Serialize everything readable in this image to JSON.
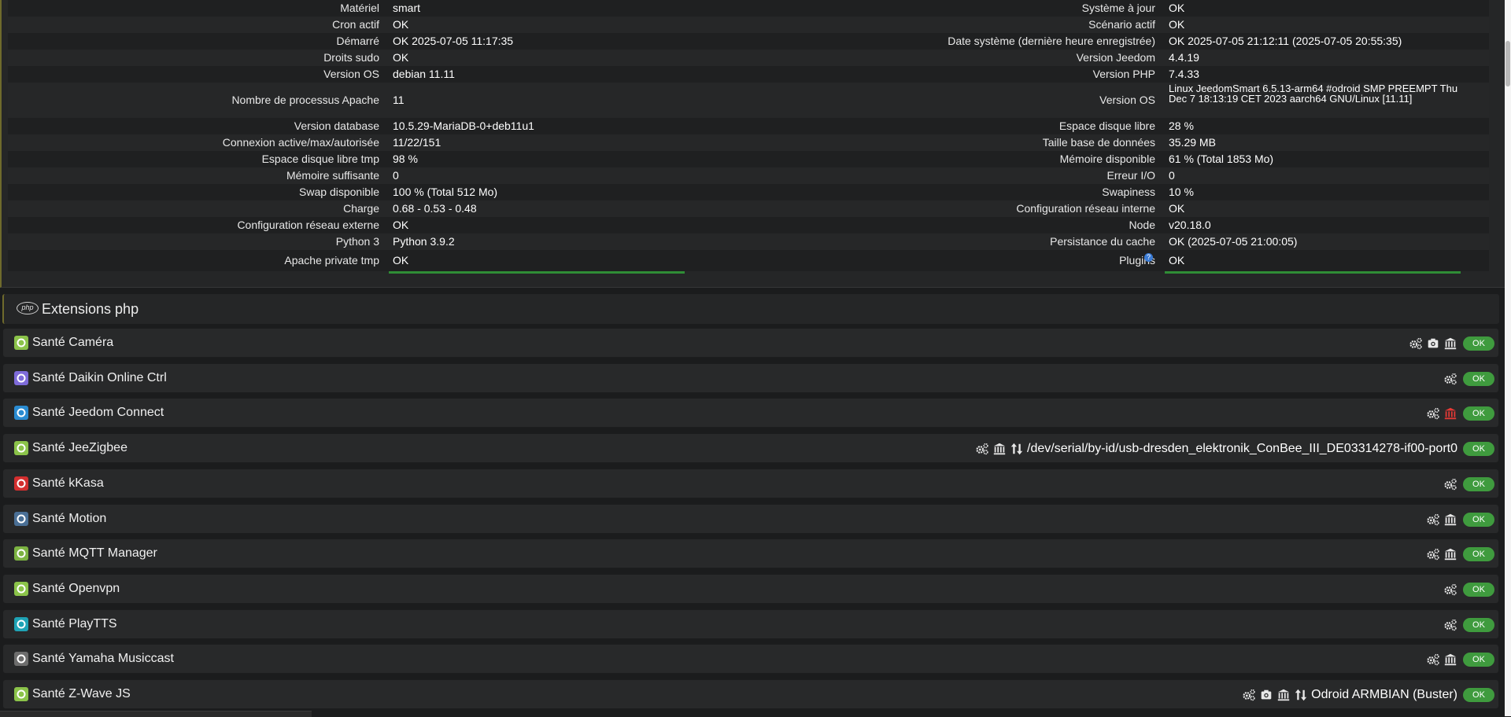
{
  "left_table": [
    {
      "label": "Matériel",
      "value": "smart"
    },
    {
      "label": "Cron actif",
      "value": "OK"
    },
    {
      "label": "Démarré",
      "value": "OK 2025-07-05 11:17:35"
    },
    {
      "label": "Droits sudo",
      "value": "OK"
    },
    {
      "label": "Version OS",
      "value": "debian 11.11"
    },
    {
      "label": "Nombre de processus Apache",
      "value": "11"
    },
    {
      "label": "Version database",
      "value": "10.5.29-MariaDB-0+deb11u1"
    },
    {
      "label": "Connexion active/max/autorisée",
      "value": "11/22/151"
    },
    {
      "label": "Espace disque libre tmp",
      "value": "98 %"
    },
    {
      "label": "Mémoire suffisante",
      "value": "0"
    },
    {
      "label": "Swap disponible",
      "value": "100 % (Total 512 Mo)"
    },
    {
      "label": "Charge",
      "value": "0.68 - 0.53 - 0.48"
    },
    {
      "label": "Configuration réseau externe",
      "value": "OK"
    },
    {
      "label": "Python 3",
      "value": "Python 3.9.2"
    },
    {
      "label": "Apache private tmp",
      "value": "OK"
    }
  ],
  "right_table": [
    {
      "label": "Système à jour",
      "value": "OK"
    },
    {
      "label": "Scénario actif",
      "value": "OK"
    },
    {
      "label": "Date système (dernière heure enregistrée)",
      "value": "OK 2025-07-05 21:12:11 (2025-07-05 20:55:35)"
    },
    {
      "label": "Version Jeedom",
      "value": "4.4.19"
    },
    {
      "label": "Version PHP",
      "value": "7.4.33"
    },
    {
      "label": "Version OS",
      "value": "Linux JeedomSmart 6.5.13-arm64 #odroid SMP PREEMPT Thu Dec 7 18:13:19 CET 2023 aarch64 GNU/Linux [11.11]"
    },
    {
      "label": "Espace disque libre",
      "value": "28 %"
    },
    {
      "label": "Taille base de données",
      "value": "35.29 MB"
    },
    {
      "label": "Mémoire disponible",
      "value": "61 % (Total 1853 Mo)"
    },
    {
      "label": "Erreur I/O",
      "value": "0"
    },
    {
      "label": "Swapiness",
      "value": "10 %"
    },
    {
      "label": "Configuration réseau interne",
      "value": "OK"
    },
    {
      "label": "Node",
      "value": "v20.18.0"
    },
    {
      "label": "Persistance du cache",
      "value": "OK (2025-07-05 21:00:05)"
    },
    {
      "label": "Plugins",
      "value": "OK"
    }
  ],
  "extensions_section": {
    "logo_text": "php",
    "title": "Extensions php"
  },
  "plugins": [
    {
      "name": "Santé Caméra",
      "status": "OK",
      "icon_color": "#8bc34a",
      "actions": [
        "cogs-icon",
        "camera-icon",
        "bank-icon"
      ],
      "port": ""
    },
    {
      "name": "Santé Daikin Online Ctrl",
      "status": "OK",
      "icon_color": "#7e6bd9",
      "actions": [
        "cogs-icon"
      ],
      "port": ""
    },
    {
      "name": "Santé Jeedom Connect",
      "status": "OK",
      "icon_color": "#2a8bd1",
      "actions": [
        "cogs-icon",
        "bank-red-icon"
      ],
      "port": ""
    },
    {
      "name": "Santé JeeZigbee",
      "status": "OK",
      "icon_color": "#8bc34a",
      "actions": [
        "cogs-icon",
        "bank-icon",
        "arrows-icon"
      ],
      "port": "/dev/serial/by-id/usb-dresden_elektronik_ConBee_III_DE03314278-if00-port0"
    },
    {
      "name": "Santé kKasa",
      "status": "OK",
      "icon_color": "#d32f2f",
      "actions": [
        "cogs-icon"
      ],
      "port": ""
    },
    {
      "name": "Santé Motion",
      "status": "OK",
      "icon_color": "#4a6f95",
      "actions": [
        "cogs-icon",
        "bank-icon"
      ],
      "port": ""
    },
    {
      "name": "Santé MQTT Manager",
      "status": "OK",
      "icon_color": "#7cb342",
      "actions": [
        "cogs-icon",
        "bank-icon"
      ],
      "port": ""
    },
    {
      "name": "Santé Openvpn",
      "status": "OK",
      "icon_color": "#8bc34a",
      "actions": [
        "cogs-icon"
      ],
      "port": ""
    },
    {
      "name": "Santé PlayTTS",
      "status": "OK",
      "icon_color": "#1fa3b5",
      "actions": [
        "cogs-icon"
      ],
      "port": ""
    },
    {
      "name": "Santé Yamaha Musiccast",
      "status": "OK",
      "icon_color": "#6d6d6d",
      "actions": [
        "cogs-icon",
        "bank-icon"
      ],
      "port": ""
    },
    {
      "name": "Santé Z-Wave JS",
      "status": "OK",
      "icon_color": "#8bc34a",
      "actions": [
        "cogs-icon",
        "camera-icon",
        "bank-icon",
        "arrows-icon"
      ],
      "port": "Odroid ARMBIAN (Buster)"
    }
  ],
  "colors": {
    "ok_green": "#2f8d36",
    "badge_green": "#3f9b3e",
    "panel": "#28292a"
  }
}
